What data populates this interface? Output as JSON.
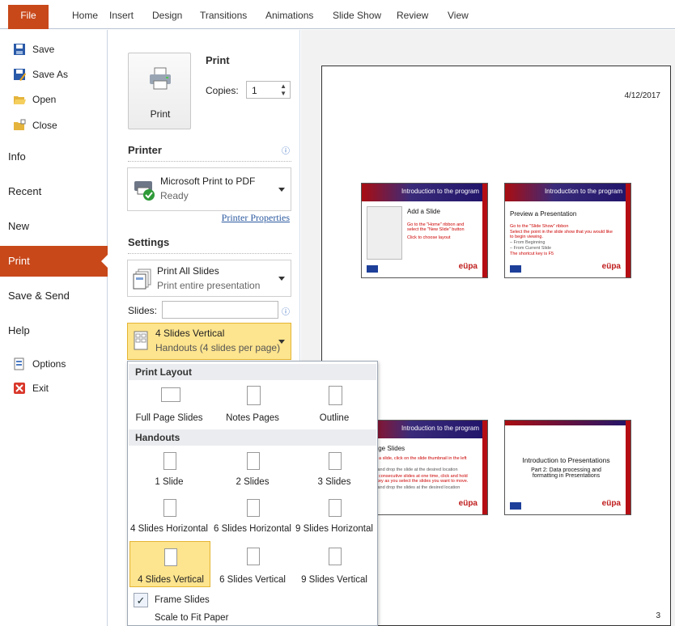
{
  "ribbon": {
    "tabs": [
      "File",
      "Home",
      "Insert",
      "Design",
      "Transitions",
      "Animations",
      "Slide Show",
      "Review",
      "View"
    ]
  },
  "nav": {
    "small_items": [
      {
        "label": "Save",
        "icon": "save-icon"
      },
      {
        "label": "Save As",
        "icon": "save-as-icon"
      },
      {
        "label": "Open",
        "icon": "folder-open-icon"
      },
      {
        "label": "Close",
        "icon": "folder-close-icon"
      }
    ],
    "big_items": [
      "Info",
      "Recent",
      "New",
      "Print",
      "Save & Send",
      "Help"
    ],
    "active": "Print",
    "bottom_items": [
      {
        "label": "Options",
        "icon": "options-icon"
      },
      {
        "label": "Exit",
        "icon": "exit-icon"
      }
    ]
  },
  "print": {
    "section_title": "Print",
    "button_label": "Print",
    "copies_label": "Copies:",
    "copies_value": "1"
  },
  "printer": {
    "section_title": "Printer",
    "name": "Microsoft Print to PDF",
    "status": "Ready",
    "properties_link": "Printer Properties"
  },
  "settings": {
    "section_title": "Settings",
    "range_title": "Print All Slides",
    "range_desc": "Print entire presentation",
    "slides_label": "Slides:",
    "slides_value": "",
    "layout_title": "4 Slides Vertical",
    "layout_desc": "Handouts (4 slides per page)"
  },
  "layout_menu": {
    "print_layout_header": "Print Layout",
    "print_layout_items": [
      "Full Page Slides",
      "Notes Pages",
      "Outline"
    ],
    "handouts_header": "Handouts",
    "handout_items": [
      "1 Slide",
      "2 Slides",
      "3 Slides",
      "4 Slides Horizontal",
      "6 Slides Horizontal",
      "9 Slides Horizontal",
      "4 Slides Vertical",
      "6 Slides Vertical",
      "9 Slides Vertical"
    ],
    "selected": "4 Slides Vertical",
    "frame_slides": "Frame Slides",
    "frame_slides_checked": true,
    "scale_to_fit": "Scale to Fit Paper"
  },
  "preview": {
    "date": "4/12/2017",
    "page_number": "3",
    "slides": [
      {
        "header": "Introduction  to the program",
        "title": "Add  a  Slide",
        "bullets": [
          "Go to the \"Home\" ribbon and select the \"New Slide\" button",
          "Click to choose layout"
        ],
        "logo": "eüpa"
      },
      {
        "header": "Introduction  to the program",
        "title": "Preview  a  Presentation",
        "bullets": [
          "Go to the \"Slide Show\" ribbon",
          "Select the point in the slide show that you would like to begin viewing.",
          "– From Beginning",
          "– From Current Slide",
          "The shortcut key is F5"
        ],
        "logo": "eüpa"
      },
      {
        "header": "Introduction  to the program",
        "title": "rrange  Slides",
        "bullets": [
          "move a slide, click on the slide thumbnail in the left umn",
          "Drag and drop the slide at the desired location",
          "move consecutive slides at one time, click and hold the t key as you select the slides you want to move.",
          "Drag and drop the slides at the desired location"
        ],
        "logo": "eüpa"
      },
      {
        "header": "",
        "title": "Introduction to Presentations",
        "subtitle": "Part 2: Data processing  and formatting  in Presentations",
        "bullets": [],
        "logo": "eüpa"
      }
    ]
  },
  "colors": {
    "accent": "#c8481a",
    "selected_fill": "#fde48e",
    "slide_red": "#b40e14",
    "slide_blue": "#21156a"
  }
}
